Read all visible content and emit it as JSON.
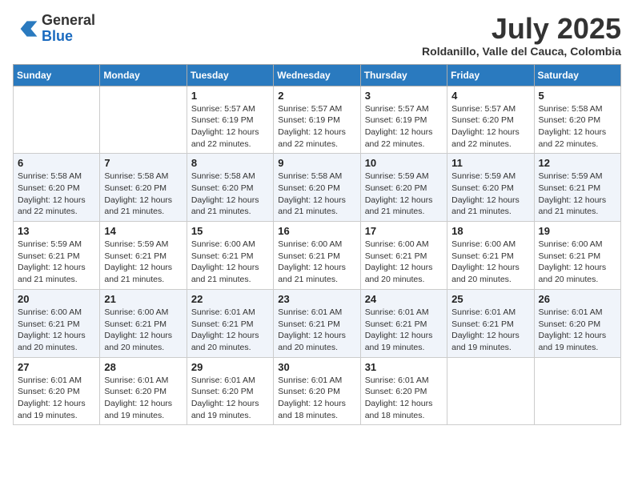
{
  "header": {
    "logo_general": "General",
    "logo_blue": "Blue",
    "month_title": "July 2025",
    "subtitle": "Roldanillo, Valle del Cauca, Colombia"
  },
  "weekdays": [
    "Sunday",
    "Monday",
    "Tuesday",
    "Wednesday",
    "Thursday",
    "Friday",
    "Saturday"
  ],
  "weeks": [
    [
      {
        "day": "",
        "info": ""
      },
      {
        "day": "",
        "info": ""
      },
      {
        "day": "1",
        "info": "Sunrise: 5:57 AM\nSunset: 6:19 PM\nDaylight: 12 hours and 22 minutes."
      },
      {
        "day": "2",
        "info": "Sunrise: 5:57 AM\nSunset: 6:19 PM\nDaylight: 12 hours and 22 minutes."
      },
      {
        "day": "3",
        "info": "Sunrise: 5:57 AM\nSunset: 6:19 PM\nDaylight: 12 hours and 22 minutes."
      },
      {
        "day": "4",
        "info": "Sunrise: 5:57 AM\nSunset: 6:20 PM\nDaylight: 12 hours and 22 minutes."
      },
      {
        "day": "5",
        "info": "Sunrise: 5:58 AM\nSunset: 6:20 PM\nDaylight: 12 hours and 22 minutes."
      }
    ],
    [
      {
        "day": "6",
        "info": "Sunrise: 5:58 AM\nSunset: 6:20 PM\nDaylight: 12 hours and 22 minutes."
      },
      {
        "day": "7",
        "info": "Sunrise: 5:58 AM\nSunset: 6:20 PM\nDaylight: 12 hours and 21 minutes."
      },
      {
        "day": "8",
        "info": "Sunrise: 5:58 AM\nSunset: 6:20 PM\nDaylight: 12 hours and 21 minutes."
      },
      {
        "day": "9",
        "info": "Sunrise: 5:58 AM\nSunset: 6:20 PM\nDaylight: 12 hours and 21 minutes."
      },
      {
        "day": "10",
        "info": "Sunrise: 5:59 AM\nSunset: 6:20 PM\nDaylight: 12 hours and 21 minutes."
      },
      {
        "day": "11",
        "info": "Sunrise: 5:59 AM\nSunset: 6:20 PM\nDaylight: 12 hours and 21 minutes."
      },
      {
        "day": "12",
        "info": "Sunrise: 5:59 AM\nSunset: 6:21 PM\nDaylight: 12 hours and 21 minutes."
      }
    ],
    [
      {
        "day": "13",
        "info": "Sunrise: 5:59 AM\nSunset: 6:21 PM\nDaylight: 12 hours and 21 minutes."
      },
      {
        "day": "14",
        "info": "Sunrise: 5:59 AM\nSunset: 6:21 PM\nDaylight: 12 hours and 21 minutes."
      },
      {
        "day": "15",
        "info": "Sunrise: 6:00 AM\nSunset: 6:21 PM\nDaylight: 12 hours and 21 minutes."
      },
      {
        "day": "16",
        "info": "Sunrise: 6:00 AM\nSunset: 6:21 PM\nDaylight: 12 hours and 21 minutes."
      },
      {
        "day": "17",
        "info": "Sunrise: 6:00 AM\nSunset: 6:21 PM\nDaylight: 12 hours and 20 minutes."
      },
      {
        "day": "18",
        "info": "Sunrise: 6:00 AM\nSunset: 6:21 PM\nDaylight: 12 hours and 20 minutes."
      },
      {
        "day": "19",
        "info": "Sunrise: 6:00 AM\nSunset: 6:21 PM\nDaylight: 12 hours and 20 minutes."
      }
    ],
    [
      {
        "day": "20",
        "info": "Sunrise: 6:00 AM\nSunset: 6:21 PM\nDaylight: 12 hours and 20 minutes."
      },
      {
        "day": "21",
        "info": "Sunrise: 6:00 AM\nSunset: 6:21 PM\nDaylight: 12 hours and 20 minutes."
      },
      {
        "day": "22",
        "info": "Sunrise: 6:01 AM\nSunset: 6:21 PM\nDaylight: 12 hours and 20 minutes."
      },
      {
        "day": "23",
        "info": "Sunrise: 6:01 AM\nSunset: 6:21 PM\nDaylight: 12 hours and 20 minutes."
      },
      {
        "day": "24",
        "info": "Sunrise: 6:01 AM\nSunset: 6:21 PM\nDaylight: 12 hours and 19 minutes."
      },
      {
        "day": "25",
        "info": "Sunrise: 6:01 AM\nSunset: 6:21 PM\nDaylight: 12 hours and 19 minutes."
      },
      {
        "day": "26",
        "info": "Sunrise: 6:01 AM\nSunset: 6:20 PM\nDaylight: 12 hours and 19 minutes."
      }
    ],
    [
      {
        "day": "27",
        "info": "Sunrise: 6:01 AM\nSunset: 6:20 PM\nDaylight: 12 hours and 19 minutes."
      },
      {
        "day": "28",
        "info": "Sunrise: 6:01 AM\nSunset: 6:20 PM\nDaylight: 12 hours and 19 minutes."
      },
      {
        "day": "29",
        "info": "Sunrise: 6:01 AM\nSunset: 6:20 PM\nDaylight: 12 hours and 19 minutes."
      },
      {
        "day": "30",
        "info": "Sunrise: 6:01 AM\nSunset: 6:20 PM\nDaylight: 12 hours and 18 minutes."
      },
      {
        "day": "31",
        "info": "Sunrise: 6:01 AM\nSunset: 6:20 PM\nDaylight: 12 hours and 18 minutes."
      },
      {
        "day": "",
        "info": ""
      },
      {
        "day": "",
        "info": ""
      }
    ]
  ]
}
